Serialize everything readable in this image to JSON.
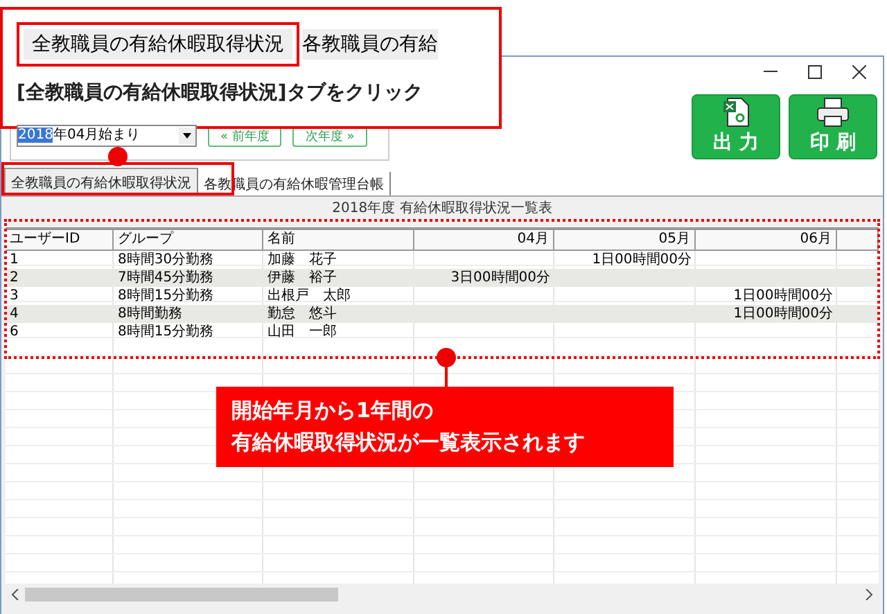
{
  "callout_top": {
    "tab_preview": [
      "全教職員の有給休暇取得状況",
      "各教職員の有給"
    ],
    "instruction": "[全教職員の有給休暇取得状況]タブをクリック"
  },
  "start_select": {
    "selected_part": "2018",
    "rest": "年04月始まり"
  },
  "nav_buttons": [
    "« 前年度",
    "次年度 »"
  ],
  "actions": [
    {
      "label": "出 力",
      "kind": "export"
    },
    {
      "label": "印 刷",
      "kind": "print"
    }
  ],
  "tabs": [
    {
      "label": "全教職員の有給休暇取得状況",
      "selected": true
    },
    {
      "label": "各教職員の有給休暇管理台帳",
      "selected": false
    }
  ],
  "sheet_title": "2018年度 有給休暇取得状況一覧表",
  "table": {
    "columns": [
      "ユーザーID",
      "グループ",
      "名前",
      "04月",
      "05月",
      "06月"
    ],
    "rows": [
      [
        "1",
        "8時間30分勤務",
        "加藤　花子",
        "",
        "1日00時間00分",
        ""
      ],
      [
        "2",
        "7時間45分勤務",
        "伊藤　裕子",
        "3日00時間00分",
        "",
        ""
      ],
      [
        "3",
        "8時間15分勤務",
        "出根戸　太郎",
        "",
        "",
        "1日00時間00分"
      ],
      [
        "4",
        "8時間勤務",
        "勤怠　悠斗",
        "",
        "",
        "1日00時間00分"
      ],
      [
        "6",
        "8時間15分勤務",
        "山田　一郎",
        "",
        "",
        ""
      ]
    ]
  },
  "callout_bottom": {
    "lines": [
      "開始年月から1年間の",
      "有給休暇取得状況が一覧表示されます"
    ]
  }
}
